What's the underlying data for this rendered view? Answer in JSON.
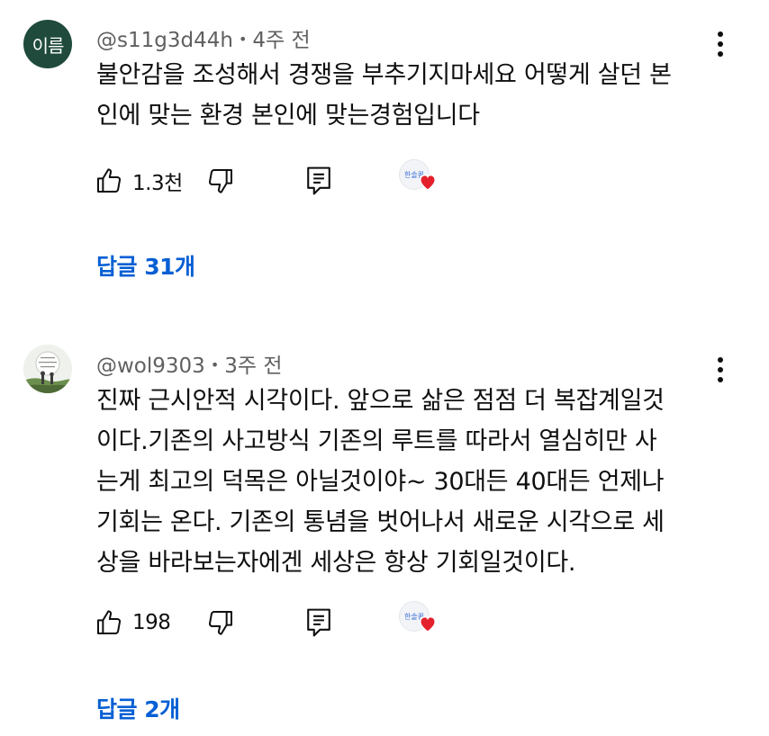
{
  "comments": [
    {
      "avatar_text": "이름",
      "handle": "@s11g3d44h",
      "separator": "•",
      "time": "4주 전",
      "lines": [
        "불안감을 조성해서 경쟁을 부추기지마세요 어떻게 살던 본",
        "인에 맞는 환경 본인에 맞는경험입니다"
      ],
      "likes": "1.3천",
      "creator_thumb_text": "한솔퀸",
      "replies_label": "답글 31개"
    },
    {
      "avatar_text": "",
      "handle": "@wol9303",
      "separator": "•",
      "time": "3주 전",
      "lines": [
        "진짜 근시안적 시각이다. 앞으로 삶은 점점 더 복잡계일것",
        "이다.기존의 사고방식 기존의 루트를 따라서 열심히만 사",
        "는게 최고의 덕목은 아닐것이야~ 30대든 40대든 언제나",
        "기회는 온다. 기존의 통념을 벗어나서 새로운 시각으로 세",
        "상을 바라보는자에겐 세상은 항상 기회일것이다."
      ],
      "likes": "198",
      "creator_thumb_text": "한솔퀸",
      "replies_label": "답글 2개"
    }
  ],
  "colors": {
    "link": "#065fd4",
    "meta": "#606060",
    "heart": "#e3202b",
    "avatar_bg": "#1f4a3c"
  },
  "icons": [
    "thumbs-up-icon",
    "thumbs-down-icon",
    "reply-icon",
    "creator-heart-icon",
    "more-vert-icon"
  ]
}
